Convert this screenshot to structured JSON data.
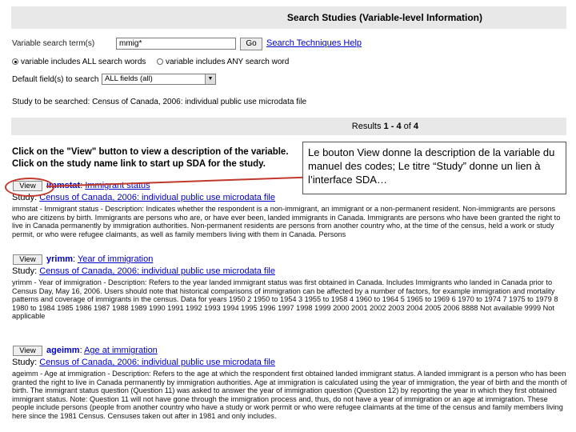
{
  "header": {
    "title": "Search Studies (Variable-level Information)"
  },
  "search": {
    "label": "Variable search term(s)",
    "value": "mmig*",
    "go_label": "Go",
    "help_label": "Search Techniques Help",
    "radio_all": "variable includes ALL search words",
    "radio_any": "variable includes ANY search word",
    "fields_label": "Default field(s) to search",
    "fields_value": "ALL fields (all)",
    "study_text": "Study to be searched: Census of Canada, 2006: individual public use microdata file"
  },
  "results": {
    "prefix": "Results",
    "range": "1 - 4",
    "of": "of",
    "total": "4"
  },
  "instructions": {
    "line1": "Click on the \"View\" button to view a description of the variable.",
    "line2": "Click on the study name link to start up SDA for the study."
  },
  "view_label": "View",
  "study_prefix": "Study:",
  "variables": [
    {
      "name": "immstat",
      "label": "Immigrant status",
      "study": "Census of Canada, 2006: individual public use microdata file",
      "desc": "immstat - Immigrant status - Description: Indicates whether the respondent is a non-immigrant, an immigrant or a non-permanent resident. Non-immigrants are persons who are citizens by birth. Immigrants are persons who are, or have ever been, landed immigrants in Canada. Immigrants are persons who have been granted the right to live in Canada permanently by immigration authorities. Non-permanent residents are persons from another country who, at the time of the census, held a work or study permit, or who were refugee claimants, as well as family members living with them in Canada. Persons"
    },
    {
      "name": "yrimm",
      "label": "Year of immigration",
      "study": "Census of Canada, 2006: individual public use microdata file",
      "desc": "yrimm - Year of immigration - Description: Refers to the year landed immigrant status was first obtained in Canada. Includes Immigrants who landed in Canada prior to Census Day, May 16, 2006. Users should note that historical comparisons of immigration can be affected by a number of factors, for example immigration and mortality patterns and coverage of immigrants in the census. Data for years 1950 2 1950 to 1954 3 1955 to 1958 4 1960 to 1964 5 1965 to 1969 6 1970 to 1974 7 1975 to 1979 8 1980 to 1984 1985 1986 1987 1988 1989 1990 1991 1992 1993 1994 1995 1996 1997 1998 1999 2000 2001 2002 2003 2004 2005 2006 8888 Not available 9999 Not applicable"
    },
    {
      "name": "ageimm",
      "label": "Age at immigration",
      "study": "Census of Canada, 2006: individual public use microdata file",
      "desc": "ageimm - Age at immigration - Description: Refers to the age at which the respondent first obtained landed immigrant status. A landed immigrant is a person who has been granted the right to live in Canada permanently by immigration authorities. Age at immigration is calculated using the year of immigration, the year of birth and the month of birth. The immigrant status question (Question 11) was asked to answer the year of immigration question (Question 12) by reporting the year in which they first obtained immigrant status. Note: Question 11 will not have gone through the immigration process and, thus, do not have a year of immigration or an age at immigration. These people include persons (people from another country who have a study or work permit or who were refugee claimants at the time of the census and family members living here since the 1981 Census. Censuses taken out after in 1981 and only includes."
    }
  ],
  "callout": {
    "text": "Le bouton View donne la description de la variable du manuel des codes; Le titre “Study” donne un lien à l’interface SDA…"
  },
  "colors": {
    "link": "#0000cc",
    "panel": "#e8e8e8",
    "annotation": "#c0392b"
  }
}
